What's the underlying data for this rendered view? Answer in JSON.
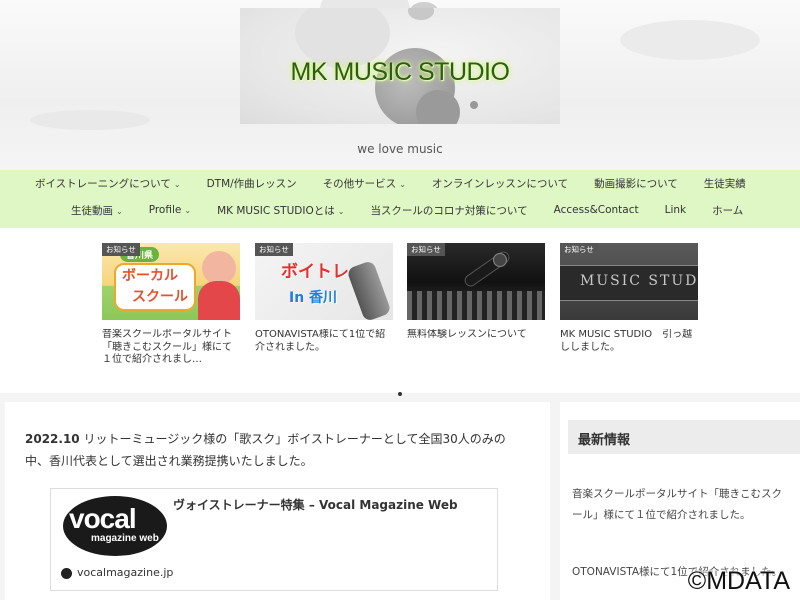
{
  "site": {
    "title": "MK MUSIC STUDIO",
    "tagline": "we love music"
  },
  "nav": {
    "row1": [
      {
        "label": "ボイストレーニングについて",
        "dropdown": true
      },
      {
        "label": "DTM/作曲レッスン",
        "dropdown": false
      },
      {
        "label": "その他サービス",
        "dropdown": true
      },
      {
        "label": "オンラインレッスンについて",
        "dropdown": false
      },
      {
        "label": "動画撮影について",
        "dropdown": false
      },
      {
        "label": "生徒実績",
        "dropdown": false
      }
    ],
    "row2": [
      {
        "label": "生徒動画",
        "dropdown": true
      },
      {
        "label": "Profile",
        "dropdown": true
      },
      {
        "label": "MK MUSIC STUDIOとは",
        "dropdown": true
      },
      {
        "label": "当スクールのコロナ対策について",
        "dropdown": false
      },
      {
        "label": "Access&Contact",
        "dropdown": false
      },
      {
        "label": "Link",
        "dropdown": false
      },
      {
        "label": "ホーム",
        "dropdown": false
      }
    ]
  },
  "carousel": {
    "cards": [
      {
        "badge": "お知らせ",
        "text": "音楽スクールポータルサイト「聴きこむスクール」様にて１位で紹介されまし…",
        "img_label_1": "香川県",
        "img_label_2": "ボーカル",
        "img_label_3": "スクール"
      },
      {
        "badge": "お知らせ",
        "text": "OTONAVISTA様にて1位で紹介されました。",
        "img_label_1": "ボイトレ",
        "img_label_2": "In 香川"
      },
      {
        "badge": "お知らせ",
        "text": "無料体験レッスンについて"
      },
      {
        "badge": "お知らせ",
        "text": "MK MUSIC STUDIO　引っ越ししました。",
        "img_label_1": "MUSIC STUD"
      }
    ]
  },
  "main": {
    "date": "2022.10",
    "body": " リットーミュージック様の「歌スク」ボイストレーナーとして全国30人のみの中、香川代表として選出され業務提携いたしました。",
    "blogcard": {
      "title": "ヴォイストレーナー特集 – Vocal Magazine Web",
      "domain": "vocalmagazine.jp",
      "logo_main": "vocal",
      "logo_sub": "magazine web"
    }
  },
  "sidebar": {
    "heading": "最新情報",
    "items": [
      "音楽スクールポータルサイト「聴きこむスクール」様にて１位で紹介されました。",
      "OTONAVISTA様にて1位で紹介されました。"
    ]
  },
  "watermark": "©MDATA"
}
